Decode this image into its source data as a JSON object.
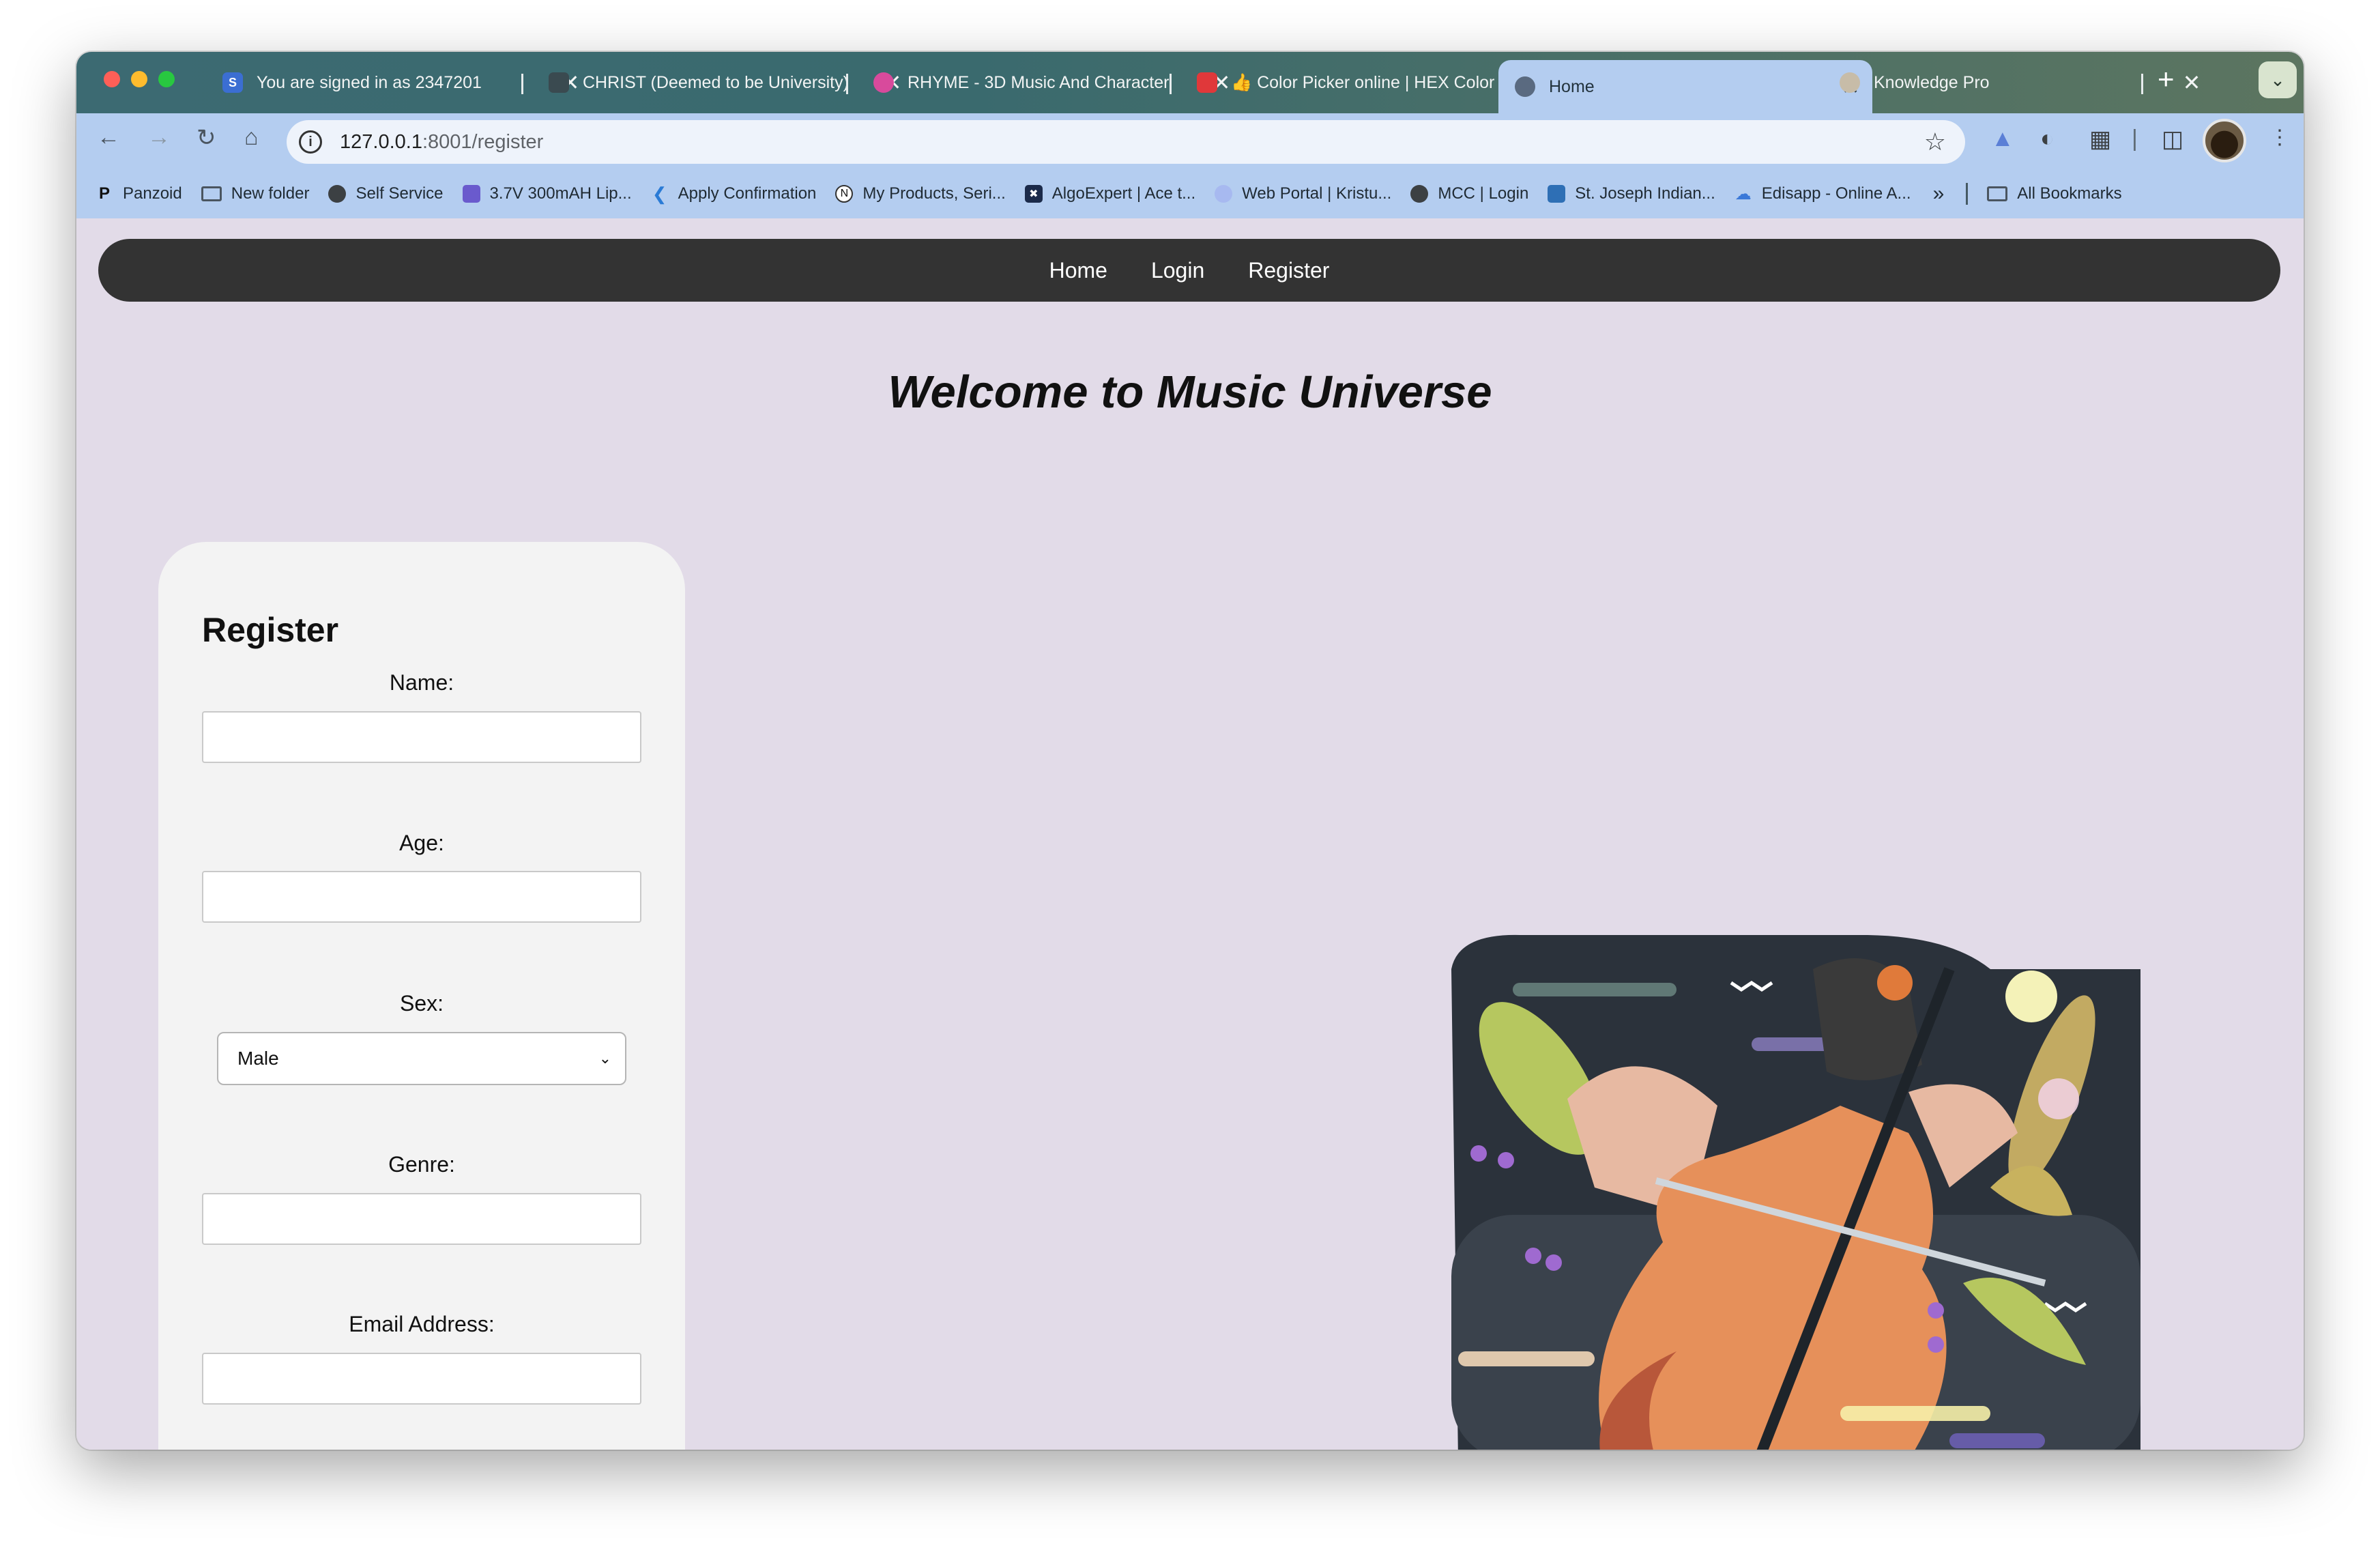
{
  "browser": {
    "tabs": [
      {
        "title": "You are signed in as 2347201",
        "favicon": "S",
        "color": "#3b6ed2"
      },
      {
        "title": "CHRIST (Deemed to be University)",
        "favicon": "",
        "color": "#3a4a50"
      },
      {
        "title": "RHYME - 3D Music And Character",
        "favicon": "",
        "color": "#d84a9c"
      },
      {
        "title": "👍 Color Picker online | HEX Color",
        "favicon": "",
        "color": "#e0383a"
      },
      {
        "title": "Home",
        "favicon": "",
        "color": "#5a6a80"
      },
      {
        "title": "Knowledge Pro",
        "favicon": "",
        "color": "#c7bca8"
      }
    ],
    "close_glyph": "✕",
    "new_tab_glyph": "+",
    "url_host": "127.0.0.1",
    "url_path": ":8001/register",
    "bookmarks": [
      {
        "label": "Panzoid",
        "icon": "panzoid-icon",
        "color": "#111111"
      },
      {
        "label": "New folder",
        "icon": "folder-icon",
        "color": "#4a5560"
      },
      {
        "label": "Self Service",
        "icon": "globe-icon",
        "color": "#3c4043"
      },
      {
        "label": "3.7V 300mAH Lip...",
        "icon": "cube-icon",
        "color": "#6a5acd"
      },
      {
        "label": "Apply Confirmation",
        "icon": "kite-icon",
        "color": "#2a7bd6"
      },
      {
        "label": "My Products, Seri...",
        "icon": "n-icon",
        "color": "#ffffff"
      },
      {
        "label": "AlgoExpert | Ace t...",
        "icon": "algoexpert-icon",
        "color": "#1b2a4a"
      },
      {
        "label": "Web Portal | Kristu...",
        "icon": "portal-icon",
        "color": "#a7b9f0"
      },
      {
        "label": "MCC | Login",
        "icon": "globe-icon",
        "color": "#3c4043"
      },
      {
        "label": "St. Joseph Indian...",
        "icon": "school-icon",
        "color": "#2e6fb5"
      },
      {
        "label": "Edisapp - Online A...",
        "icon": "cloud-icon",
        "color": "#3a78d8"
      }
    ],
    "more_bookmarks": "»",
    "all_bookmarks": "All Bookmarks"
  },
  "page": {
    "nav": [
      "Home",
      "Login",
      "Register"
    ],
    "heading": "Welcome to Music Universe",
    "form": {
      "title": "Register",
      "name_label": "Name:",
      "age_label": "Age:",
      "sex_label": "Sex:",
      "sex_value": "Male",
      "genre_label": "Genre:",
      "email_label": "Email Address:"
    }
  }
}
